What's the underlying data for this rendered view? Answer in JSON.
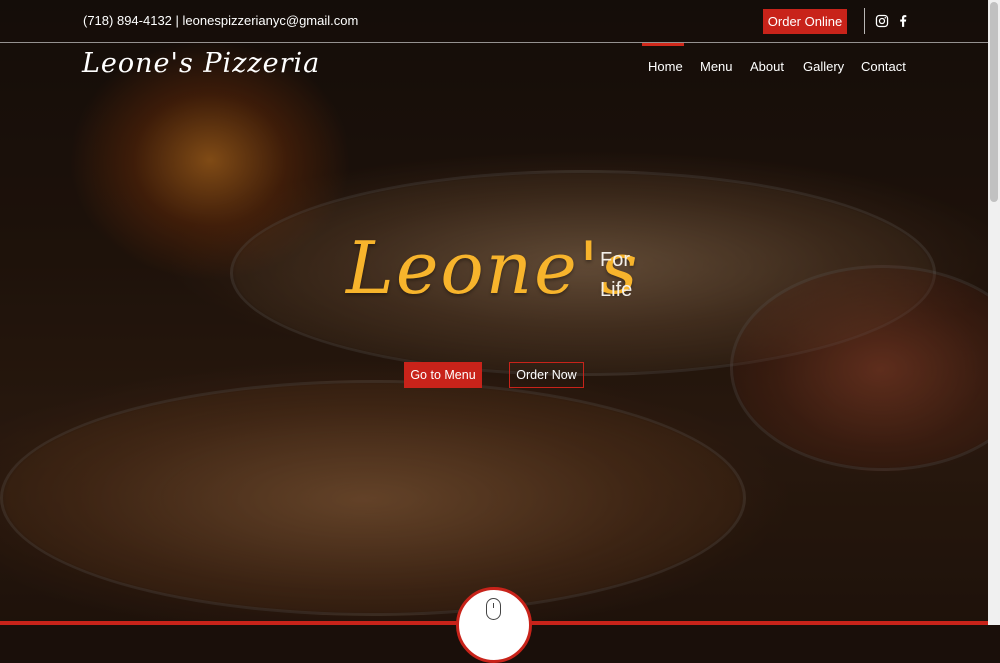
{
  "topbar": {
    "phone": "(718) 894-4132",
    "separator": "|",
    "email": "leonespizzerianyc@gmail.com",
    "order_online_label": "Order Online",
    "social_icons": [
      "instagram-icon",
      "facebook-icon"
    ]
  },
  "header": {
    "logo": "Leone's Pizzeria",
    "nav": [
      "Home",
      "Menu",
      "About",
      "Gallery",
      "Contact"
    ],
    "active_nav": "Home"
  },
  "hero": {
    "title": "Leone's",
    "tagline_line1": "For",
    "tagline_line2": "Life",
    "go_to_menu_label": "Go to Menu",
    "order_now_label": "Order Now"
  },
  "colors": {
    "accent_red": "#c8231a",
    "title_gold": "#f7b42c"
  },
  "scroll_indicator_icon": "mouse-icon"
}
